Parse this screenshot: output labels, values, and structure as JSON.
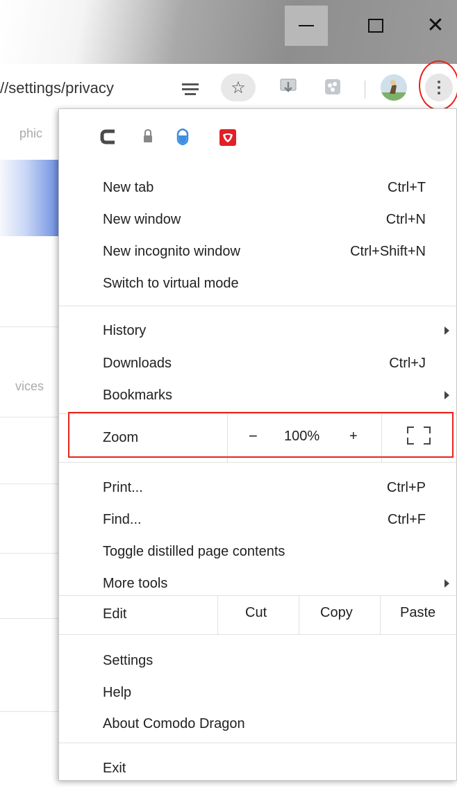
{
  "window": {
    "controls": [
      "minimize",
      "maximize",
      "close"
    ]
  },
  "toolbar": {
    "url": "//settings/privacy",
    "icons": [
      "reader-mode-icon",
      "bookmark-star-icon",
      "download-icon",
      "extension-icon",
      "profile-avatar",
      "more-menu-icon"
    ]
  },
  "background_page": {
    "text_top": "phic",
    "text_mid": "vices"
  },
  "menu": {
    "extension_icons": [
      "comodo-c-icon",
      "lock-icon",
      "shield-icon",
      "red-extension-icon"
    ],
    "group1": [
      {
        "label": "New tab",
        "shortcut": "Ctrl+T"
      },
      {
        "label": "New window",
        "shortcut": "Ctrl+N"
      },
      {
        "label": "New incognito window",
        "shortcut": "Ctrl+Shift+N"
      },
      {
        "label": "Switch to virtual mode",
        "shortcut": ""
      }
    ],
    "group2": [
      {
        "label": "History",
        "shortcut": ""
      },
      {
        "label": "Downloads",
        "shortcut": "Ctrl+J"
      },
      {
        "label": "Bookmarks",
        "shortcut": ""
      }
    ],
    "zoom": {
      "label": "Zoom",
      "minus": "−",
      "value": "100%",
      "plus": "+"
    },
    "group3": [
      {
        "label": "Print...",
        "shortcut": "Ctrl+P"
      },
      {
        "label": "Find...",
        "shortcut": "Ctrl+F"
      },
      {
        "label": "Toggle distilled page contents",
        "shortcut": ""
      },
      {
        "label": "More tools",
        "shortcut": ""
      }
    ],
    "edit": {
      "label": "Edit",
      "cut": "Cut",
      "copy": "Copy",
      "paste": "Paste"
    },
    "group4": [
      {
        "label": "Settings"
      },
      {
        "label": "Help"
      },
      {
        "label": "About Comodo Dragon"
      }
    ],
    "exit": {
      "label": "Exit"
    }
  },
  "colors": {
    "highlight_red": "#e8231b",
    "accent_blue": "#6d8fe0"
  }
}
